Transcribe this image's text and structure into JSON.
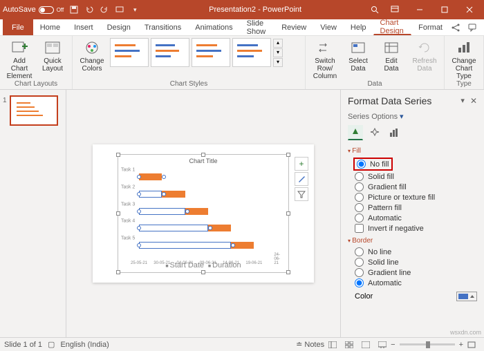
{
  "titlebar": {
    "autosave_label": "AutoSave",
    "autosave_state": "Off",
    "title": "Presentation2 - PowerPoint"
  },
  "menu": {
    "file": "File",
    "tabs": [
      "Home",
      "Insert",
      "Design",
      "Transitions",
      "Animations",
      "Slide Show",
      "Review",
      "View",
      "Help",
      "Chart Design",
      "Format"
    ],
    "active": "Chart Design"
  },
  "ribbon": {
    "add_chart_element": "Add Chart\nElement",
    "quick_layout": "Quick\nLayout",
    "change_colors": "Change\nColors",
    "switch_row_col": "Switch Row/\nColumn",
    "select_data": "Select\nData",
    "edit_data": "Edit\nData",
    "refresh_data": "Refresh\nData",
    "change_chart_type": "Change\nChart Type",
    "groups": {
      "layouts": "Chart Layouts",
      "styles": "Chart Styles",
      "data": "Data",
      "type": "Type"
    }
  },
  "slide": {
    "chart_title": "Chart Title",
    "y_labels": [
      "Task 1",
      "Task 2",
      "Task 3",
      "Task 4",
      "Task 5"
    ],
    "x_labels": [
      "25-05-21",
      "30-05-21",
      "04-06-21",
      "09-06-21",
      "14-06-21",
      "19-06-21",
      "24-06-21"
    ],
    "legend_start": "Start Date",
    "legend_dur": "Duration"
  },
  "chart_data": {
    "type": "bar",
    "orientation": "horizontal",
    "stacked": true,
    "title": "Chart Title",
    "categories": [
      "Task 1",
      "Task 2",
      "Task 3",
      "Task 4",
      "Task 5"
    ],
    "series": [
      {
        "name": "Start Date",
        "values": [
          "25-05-21",
          "30-05-21",
          "04-06-21",
          "09-06-21",
          "14-06-21"
        ],
        "fill": "none"
      },
      {
        "name": "Duration",
        "values": [
          5,
          5,
          5,
          5,
          5
        ]
      }
    ],
    "xlabel": "",
    "ylabel": "",
    "x_ticks": [
      "25-05-21",
      "30-05-21",
      "04-06-21",
      "09-06-21",
      "14-06-21",
      "19-06-21",
      "24-06-21"
    ]
  },
  "pane": {
    "title": "Format Data Series",
    "subtitle": "Series Options",
    "fill": {
      "heading": "Fill",
      "options": [
        "No fill",
        "Solid fill",
        "Gradient fill",
        "Picture or texture fill",
        "Pattern fill",
        "Automatic"
      ],
      "selected": "No fill",
      "invert": "Invert if negative"
    },
    "border": {
      "heading": "Border",
      "options": [
        "No line",
        "Solid line",
        "Gradient line",
        "Automatic"
      ],
      "selected": "Automatic",
      "color_label": "Color"
    }
  },
  "status": {
    "slide": "Slide 1 of 1",
    "lang": "English (India)",
    "notes": "Notes"
  },
  "watermark": "wsxdn.com"
}
